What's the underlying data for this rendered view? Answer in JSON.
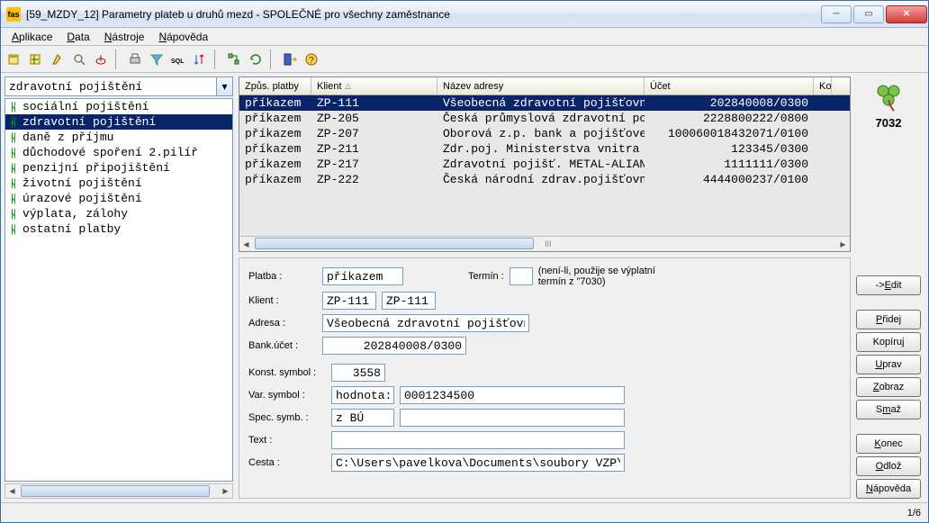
{
  "window": {
    "icon_text": "fas",
    "title": "[59_MZDY_12] Parametry plateb u druhů mezd - SPOLEČNÉ pro všechny zaměstnance"
  },
  "menu": {
    "aplikace": "Aplikace",
    "data": "Data",
    "nastroje": "Nástroje",
    "napoveda": "Nápověda"
  },
  "sidebar": {
    "combo_value": "zdravotní pojištění",
    "items": [
      {
        "label": "sociální pojištění",
        "selected": false
      },
      {
        "label": "zdravotní pojištění",
        "selected": true
      },
      {
        "label": "daně z příjmu",
        "selected": false
      },
      {
        "label": "důchodové spoření 2.pilíř",
        "selected": false
      },
      {
        "label": "penzijní připojištění",
        "selected": false
      },
      {
        "label": "životní pojištění",
        "selected": false
      },
      {
        "label": "úrazové pojištění",
        "selected": false
      },
      {
        "label": "výplata, zálohy",
        "selected": false
      },
      {
        "label": "ostatní platby",
        "selected": false
      }
    ]
  },
  "grid": {
    "headers": {
      "c1": "Způs. platby",
      "c2": "Klient",
      "c3": "Název adresy",
      "c4": "Účet",
      "c5": "Ko"
    },
    "rows": [
      {
        "c1": "příkazem",
        "c2": "ZP-111",
        "c3": "Všeobecná zdravotní pojišťovna",
        "c4": "202840008/0300",
        "sel": true
      },
      {
        "c1": "příkazem",
        "c2": "ZP-205",
        "c3": "Česká průmyslová zdravotní poj",
        "c4": "2228800222/0800",
        "sel": false
      },
      {
        "c1": "příkazem",
        "c2": "ZP-207",
        "c3": "Oborová z.p. bank a pojišťoven",
        "c4": "100060018432071/0100",
        "sel": false
      },
      {
        "c1": "příkazem",
        "c2": "ZP-211",
        "c3": "Zdr.poj. Ministerstva vnitra",
        "c4": "123345/0300",
        "sel": false
      },
      {
        "c1": "příkazem",
        "c2": "ZP-217",
        "c3": "Zdravotní pojišť.  METAL-ALIAN",
        "c4": "1111111/0300",
        "sel": false
      },
      {
        "c1": "příkazem",
        "c2": "ZP-222",
        "c3": "Česká národní zdrav.pojišťovna",
        "c4": "4444000237/0100",
        "sel": false
      }
    ],
    "scroll_tick": "III"
  },
  "form": {
    "platba_label": "Platba :",
    "platba_value": "příkazem",
    "termin_label": "Termín :",
    "termin_value": "",
    "termin_note1": "(není-li, použije se výplatní",
    "termin_note2": "termín z \"7030)",
    "klient_label": "Klient :",
    "klient_code": "ZP-111",
    "klient_name": "ZP-111",
    "adresa_label": "Adresa :",
    "adresa_value": "Všeobecná zdravotní pojišťovna",
    "bankucet_label": "Bank.účet :",
    "bankucet_value": "202840008/0300",
    "konst_label": "Konst. symbol :",
    "konst_value": "3558",
    "var_label": "Var. symbol :",
    "var_kind": "hodnota:",
    "var_value": "0001234500",
    "spec_label": "Spec. symb. :",
    "spec_kind": "z BÚ",
    "spec_value": "",
    "text_label": "Text :",
    "text_value": "",
    "cesta_label": "Cesta :",
    "cesta_value": "C:\\Users\\pavelkova\\Documents\\soubory VZP\\"
  },
  "logo": {
    "number": "7032"
  },
  "buttons": {
    "edit": "-> Edit",
    "pridej": "Přidej",
    "kopiruj": "Kopíruj",
    "uprav": "Uprav",
    "zobraz": "Zobraz",
    "smaz": "Smaž",
    "konec": "Konec",
    "odloz": "Odlož",
    "napoveda": "Nápověda"
  },
  "status": {
    "left": "",
    "right": "1/6"
  }
}
